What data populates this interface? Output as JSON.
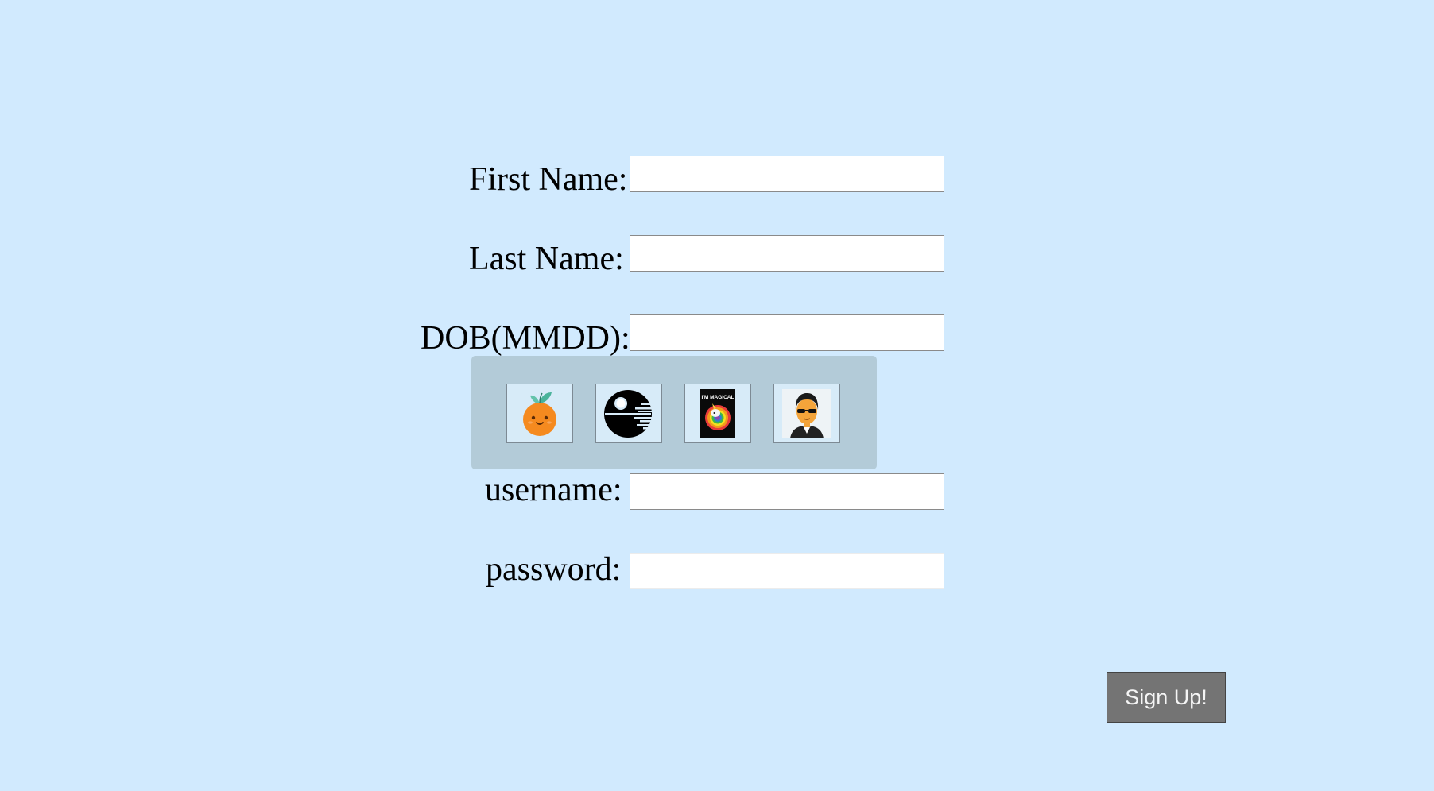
{
  "form": {
    "first_name": {
      "label": "First Name:",
      "value": ""
    },
    "last_name": {
      "label": "Last Name:",
      "value": ""
    },
    "dob": {
      "label": "DOB(MMDD):",
      "value": ""
    },
    "username": {
      "label": "username:",
      "value": ""
    },
    "password": {
      "label": "password:",
      "value": ""
    }
  },
  "avatars": [
    {
      "icon": "orange-fruit-icon"
    },
    {
      "icon": "death-star-icon"
    },
    {
      "icon": "im-magical-unicorn-icon",
      "text": "I'M MAGICAL"
    },
    {
      "icon": "person-sunglasses-icon"
    }
  ],
  "signup_label": "Sign Up!",
  "colors": {
    "background": "#d1eafe",
    "avatar_panel": "#b3cbd8",
    "button": "#747474",
    "button_text": "#f5f5f5"
  }
}
